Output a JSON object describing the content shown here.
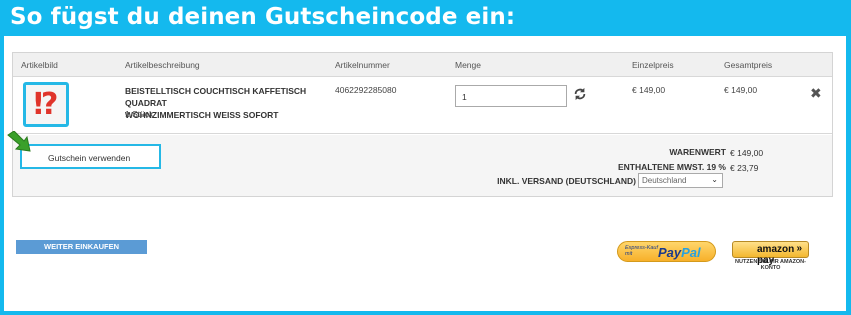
{
  "banner": {
    "title": "So fügst du deinen Gutscheincode ein:"
  },
  "cart": {
    "columns": [
      "Artikelbild",
      "Artikelbeschreibung",
      "Artikelnummer",
      "Menge",
      "Einzelpreis",
      "Gesamtpreis"
    ],
    "item": {
      "image_glyph": "⁉",
      "description_line1": "BEISTELLTISCH COUCHTISCH KAFFETISCH QUADRAT",
      "description_line2": "WOHNZIMMERTISCH WEISS SOFORT",
      "quantity_text": "1 Stück",
      "article_number": "4062292285080",
      "quantity_value": "1",
      "unit_price": "€ 149,00",
      "total_price": "€ 149,00"
    },
    "voucher_button": "Gutschein verwenden",
    "summary": {
      "goods_value_label": "WARENWERT",
      "goods_value": "€ 149,00",
      "vat_label": "ENTHALTENE MWST. 19 %",
      "vat_value": "€ 23,79",
      "shipping_label": "INKL. VERSAND (DEUTSCHLAND)",
      "shipping_country_selected": "Deutschland"
    }
  },
  "actions": {
    "continue_shopping": "WEITER EINKAUFEN",
    "paypal_small_line1": "Express-Kauf",
    "paypal_small_line2": "mit",
    "paypal_logo_pay": "Pay",
    "paypal_logo_pal": "Pal",
    "amazon_logo": "amazon pay",
    "amazon_chevron": "»",
    "amazon_sub": "NUTZEN SIE IHR AMAZON-KONTO"
  },
  "colors": {
    "banner": "#14b9ee",
    "highlight": "#25b8e6",
    "arrow": "#3aa02a"
  }
}
